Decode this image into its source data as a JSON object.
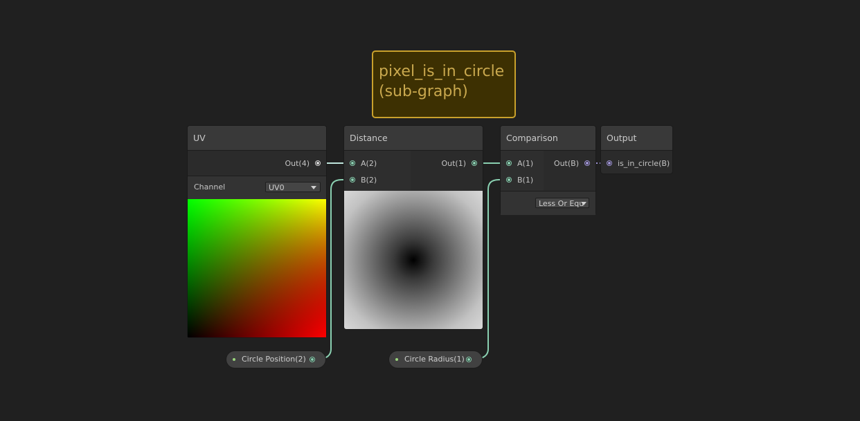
{
  "sticky_note": {
    "text": "pixel_is_in_circle (sub-graph)"
  },
  "nodes": {
    "uv": {
      "title": "UV",
      "output_label": "Out(4)",
      "channel_label": "Channel",
      "channel_value": "UV0"
    },
    "distance": {
      "title": "Distance",
      "input_a": "A(2)",
      "input_b": "B(2)",
      "output_label": "Out(1)"
    },
    "comparison": {
      "title": "Comparison",
      "input_a": "A(1)",
      "input_b": "B(1)",
      "output_label": "Out(B)",
      "mode_value": "Less Or Equ"
    },
    "output": {
      "title": "Output",
      "input_label": "is_in_circle(B)"
    }
  },
  "properties": {
    "circle_position": "Circle Position(2)",
    "circle_radius": "Circle Radius(1)"
  },
  "colors": {
    "background": "#202020",
    "sticky_border": "#c9a12c",
    "sticky_text": "#c9a84e",
    "wire_vector": "#8ad0b1",
    "wire_boolean": "#9f94d6"
  }
}
